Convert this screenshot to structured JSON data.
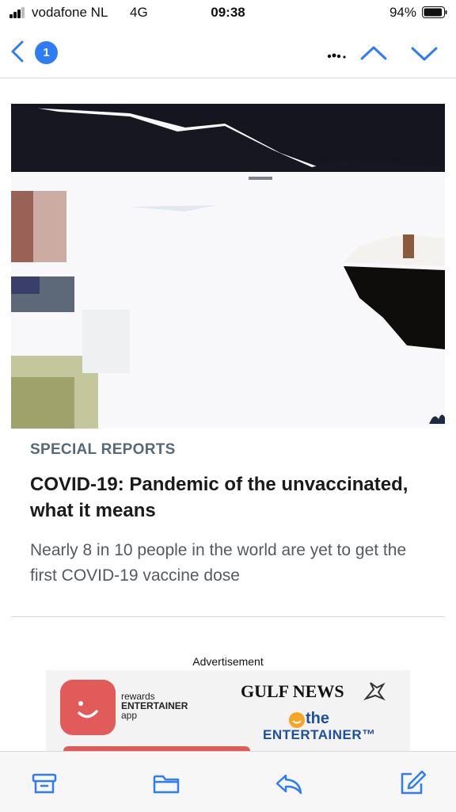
{
  "status_bar": {
    "carrier": "vodafone NL",
    "network": "4G",
    "time": "09:38",
    "battery": "94%",
    "battery_level": 0.94
  },
  "nav": {
    "unread_count": "1"
  },
  "article": {
    "category": "SPECIAL REPORTS",
    "headline": "COVID-19: Pandemic of the unvaccinated, what it means",
    "subtitle": "Nearly 8 in 10 people in the world are yet to get the first COVID-19 vaccine dose"
  },
  "advertisement": {
    "label": "Advertisement",
    "rewards_lines": [
      "rewards",
      "ENTERTAINER",
      "app"
    ],
    "gulf_news": "GULF NEWS",
    "the": "the",
    "entertainer": "ENTERTAINER™"
  },
  "colors": {
    "accent": "#2f7df6",
    "brand_red": "#e25b5b",
    "category_text": "#56687a"
  },
  "icons": [
    "chevron-left-icon",
    "more-icon",
    "chevron-up-icon",
    "chevron-down-icon",
    "archive-icon",
    "folder-icon",
    "reply-icon",
    "compose-icon"
  ]
}
